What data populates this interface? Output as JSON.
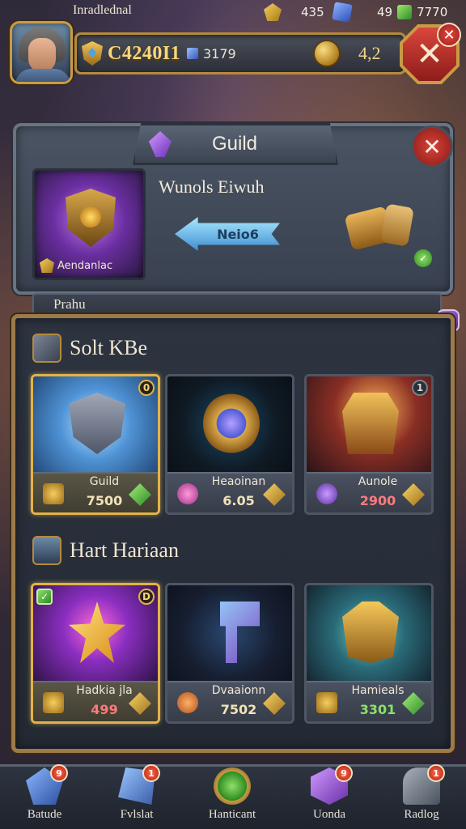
{
  "status_bar": {
    "title": "Inradlednal",
    "stat1_value": "435",
    "stat2_value": "49",
    "stat3_value": "7770"
  },
  "resources": {
    "gold": "C4240I1",
    "gems": "3179",
    "coins": "4,2"
  },
  "guild_panel": {
    "title": "Guild",
    "emblem_label": "Aendanlac",
    "subtitle": "Wunols Eiwuh",
    "arrow_button": "Neio6",
    "subtab_label": "Prahu"
  },
  "section1": {
    "title": "Solt KBe",
    "cards": [
      {
        "name": "Guild",
        "price": "7500",
        "badge": "0"
      },
      {
        "name": "Heaoinan",
        "price": "6.05",
        "badge": ""
      },
      {
        "name": "Aunole",
        "price": "2900",
        "badge": "1"
      }
    ]
  },
  "section2": {
    "title": "Hart Hariaan",
    "cards": [
      {
        "name": "Hadkia jla",
        "price": "499",
        "badge": "D"
      },
      {
        "name": "Dvaaionn",
        "price": "7502",
        "badge": ""
      },
      {
        "name": "Hamieals",
        "price": "3301",
        "badge": ""
      }
    ]
  },
  "bottom_nav": [
    {
      "label": "Batude",
      "badge": "9"
    },
    {
      "label": "Fvlslat",
      "badge": "1"
    },
    {
      "label": "Hanticant",
      "badge": ""
    },
    {
      "label": "Uonda",
      "badge": "9"
    },
    {
      "label": "Radlog",
      "badge": "1"
    }
  ],
  "colors": {
    "accent_gold": "#c99b45",
    "close_red": "#d84338",
    "panel_slate": "#4a5463"
  }
}
